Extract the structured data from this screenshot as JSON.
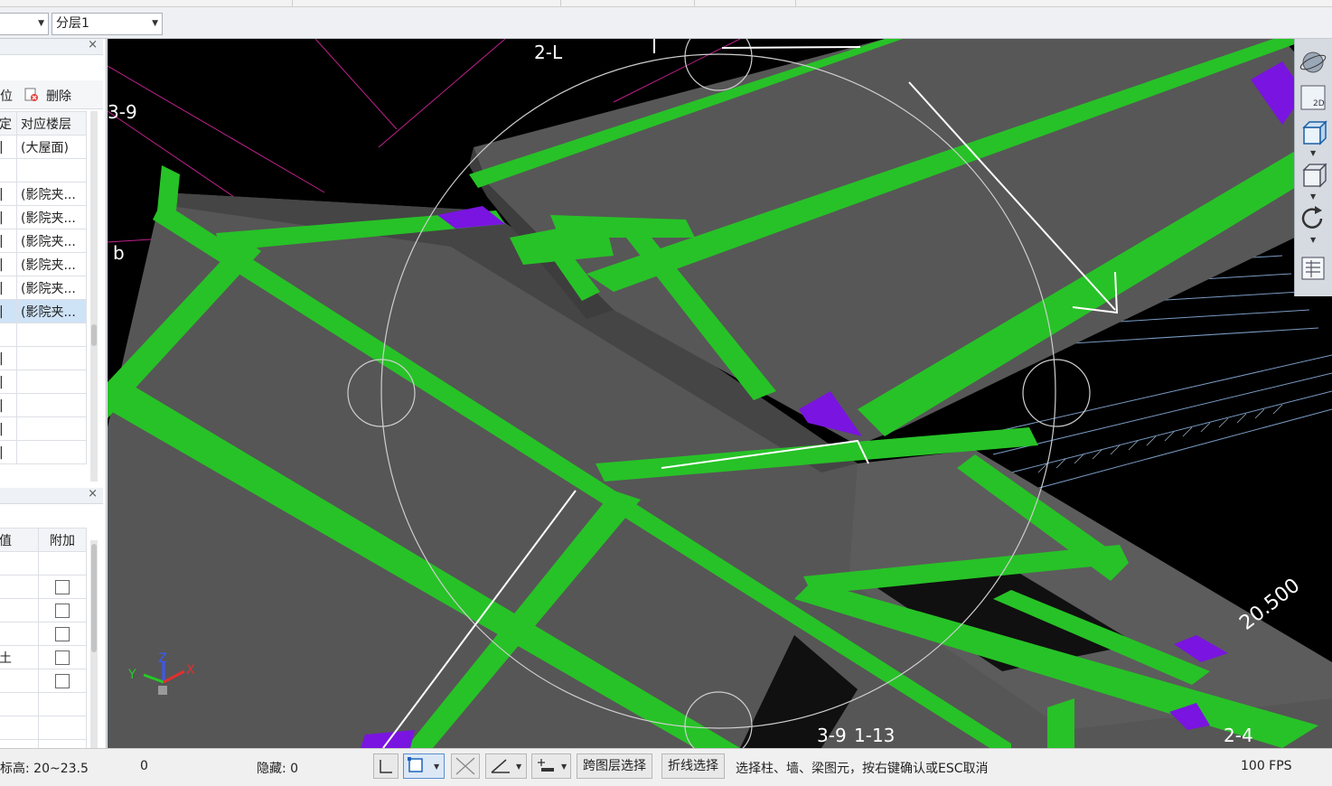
{
  "toolbar": {
    "combo_left_value": "",
    "combo_layer_value": "分层1"
  },
  "panel_top": {
    "btn_locate": "位",
    "btn_delete": "删除",
    "col_a": "定",
    "col_b": "对应楼层",
    "rows": [
      "(大屋面)",
      "",
      "(影院夹...",
      "(影院夹...",
      "(影院夹...",
      "(影院夹...",
      "(影院夹...",
      "(影院夹..."
    ]
  },
  "panel_bottom": {
    "col_a": "值",
    "col_b": "附加",
    "row_a_texts": [
      "",
      "",
      "",
      "",
      "土",
      ""
    ]
  },
  "viewport": {
    "axis_labels": [
      "2-L",
      "3-9",
      "b",
      "3-9",
      "1-13",
      "2-4"
    ],
    "elevation_tag": "20.500",
    "gizmo": {
      "x": "X",
      "y": "Y",
      "z": "Z"
    }
  },
  "right_tools": [
    "orbit-tool",
    "2d-view-tool",
    "3d-view-tool",
    "box-view-tool",
    "rotate-tool",
    "properties-tool"
  ],
  "statusbar": {
    "elevation": "标高:  20~23.5",
    "zero": "0",
    "hidden": "隐藏:  0",
    "cross_layer_btn": "跨图层选择",
    "polyline_btn": "折线选择",
    "hint": "选择柱、墙、梁图元，按右键确认或ESC取消",
    "fps": "100 FPS"
  }
}
